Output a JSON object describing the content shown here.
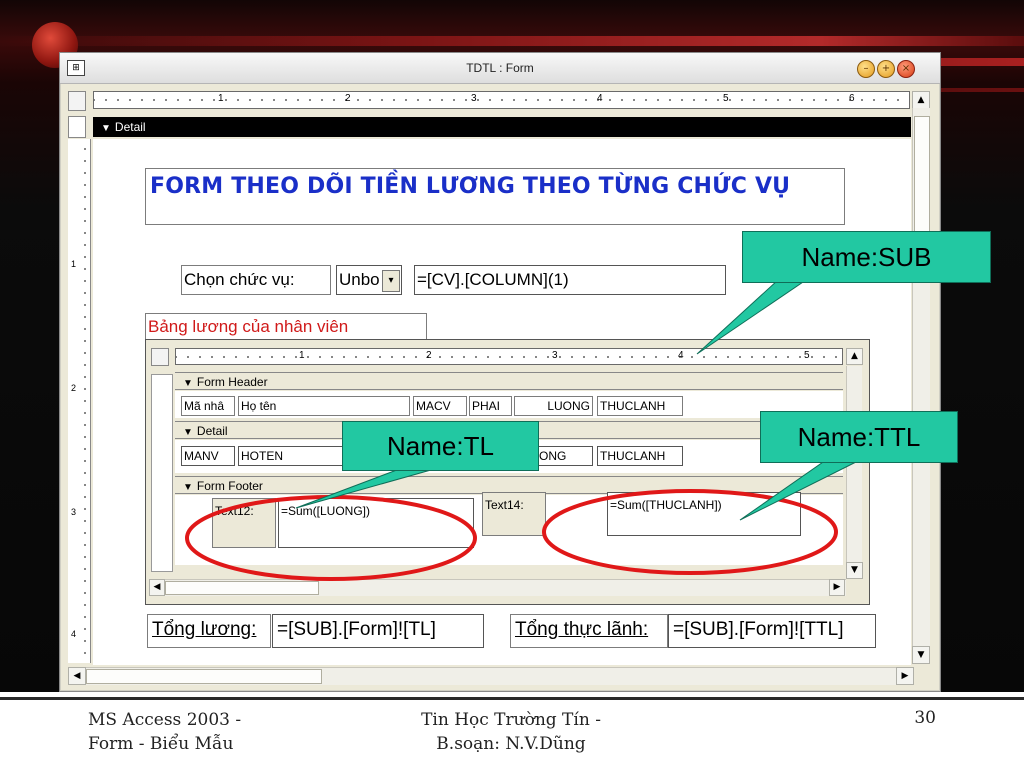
{
  "window": {
    "title": "TDTL : Form",
    "icon": "form-view-icon",
    "title_icon_glyph": "⊞",
    "buttons": {
      "min": "–",
      "max": "+",
      "close": "×"
    }
  },
  "ruler": {
    "numbers": [
      "1",
      "2",
      "3",
      "4",
      "5",
      "6"
    ],
    "vnumbers": [
      "1",
      "2",
      "3",
      "4"
    ]
  },
  "sections": {
    "detail": "Detail"
  },
  "main": {
    "title": "FORM THEO DÕI TIỀN LƯƠNG THEO TỪNG CHỨC VỤ",
    "chon_label": "Chọn chức vụ:",
    "combo_value": "Unbo",
    "combo_arrow": "▾",
    "cv_field": "=[CV].[COLUMN](1)",
    "subform_label": "Bảng lương của nhân viên"
  },
  "subform": {
    "ruler_numbers": [
      "1",
      "2",
      "3",
      "4",
      "5"
    ],
    "form_header": "Form Header",
    "detail": "Detail",
    "form_footer": "Form Footer",
    "header_labels": [
      "Mã nhâ",
      "Họ tên",
      "MACV",
      "PHAI",
      "LUONG",
      "THUCLANH"
    ],
    "detail_fields": [
      "MANV",
      "HOTEN",
      "",
      "",
      "ONG",
      "THUCLANH"
    ],
    "footer": {
      "text12_label": "Text12:",
      "text12_value": "=Sum([LUONG])",
      "text14_label": "Text14:",
      "text14_value": "=Sum([THUCLANH])"
    }
  },
  "totals": {
    "tong_luong_label": "Tổng lương:",
    "tong_luong_value": "=[SUB].[Form]![TL]",
    "tong_thuc_lanh_label": "Tổng thực lãnh:",
    "tong_thuc_lanh_value": "=[SUB].[Form]![TTL]"
  },
  "callouts": {
    "sub": "Name:SUB",
    "tl": "Name:TL",
    "ttl": "Name:TTL"
  },
  "colors": {
    "title_blue": "#1a2fc8",
    "subform_label_red": "#d01a1a",
    "callout_teal": "#22c8a2",
    "ellipse_red": "#e01818"
  },
  "footer": {
    "left_line1": "MS Access 2003 -",
    "left_line2": "Form - Biểu Mẫu",
    "mid_line1": "Tin Học Trường Tín -",
    "mid_line2": "B.soạn: N.V.Dũng",
    "page": "30"
  }
}
